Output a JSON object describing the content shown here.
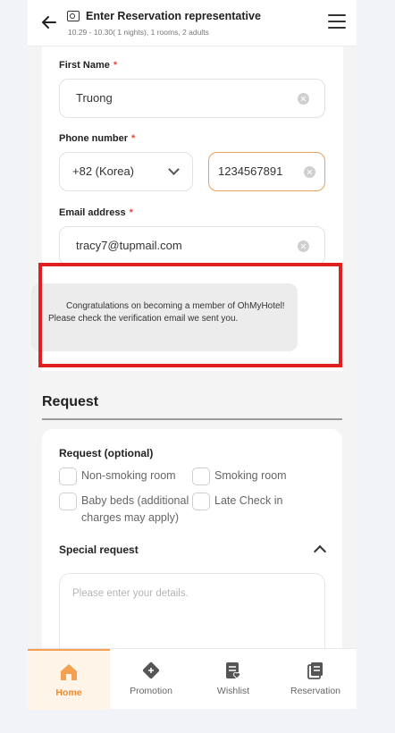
{
  "header": {
    "title": "Enter Reservation representative",
    "subtitle": "10.29 - 10.30( 1 nights), 1 rooms, 2 adults"
  },
  "form": {
    "first_name": {
      "label": "First Name",
      "required": "*",
      "value": "Truong"
    },
    "phone": {
      "label": "Phone number",
      "required": "*",
      "country": "+82 (Korea)",
      "value": "1234567891"
    },
    "email": {
      "label": "Email address",
      "required": "*",
      "value": "tracy7@tupmail.com"
    },
    "notice": "Congratulations on becoming a member of OhMyHotel! Please check the verification email we sent you."
  },
  "request": {
    "section_title": "Request",
    "optional_title": "Request (optional)",
    "options": [
      "Non-smoking room",
      "Smoking room",
      "Baby beds (additional charges may apply)",
      "Late Check in"
    ],
    "special_title": "Special request",
    "special_placeholder": "Please enter your details."
  },
  "nav": {
    "items": [
      {
        "label": "Home",
        "icon": "home-icon",
        "active": true
      },
      {
        "label": "Promotion",
        "icon": "promotion-icon",
        "active": false
      },
      {
        "label": "Wishlist",
        "icon": "wishlist-icon",
        "active": false
      },
      {
        "label": "Reservation",
        "icon": "reservation-icon",
        "active": false
      }
    ]
  },
  "colors": {
    "accent": "#f08a2a",
    "highlight": "#e01f1f",
    "required": "#e84a3c"
  }
}
